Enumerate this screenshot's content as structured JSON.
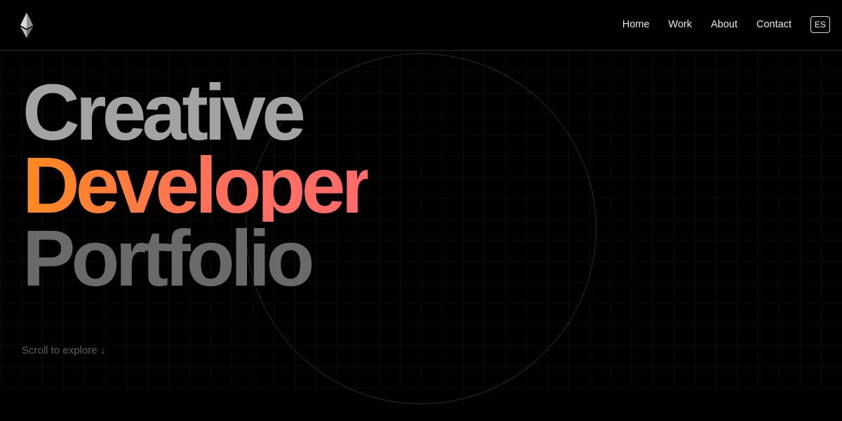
{
  "header": {
    "logo_icon": "ethereum-diamond-icon",
    "nav": [
      {
        "label": "Home"
      },
      {
        "label": "Work"
      },
      {
        "label": "About"
      },
      {
        "label": "Contact"
      }
    ],
    "language_button": "ES"
  },
  "hero": {
    "line1": "Creative",
    "line2": "Developer",
    "line3": "Portfolio",
    "scroll_hint": "Scroll to explore ↓"
  },
  "colors": {
    "background": "#000000",
    "accent_gradient_start": "#ff8a1c",
    "accent_gradient_end": "#ff6b6b",
    "heading_light": "#a3a3a3",
    "heading_dark": "#6a6a6a"
  }
}
